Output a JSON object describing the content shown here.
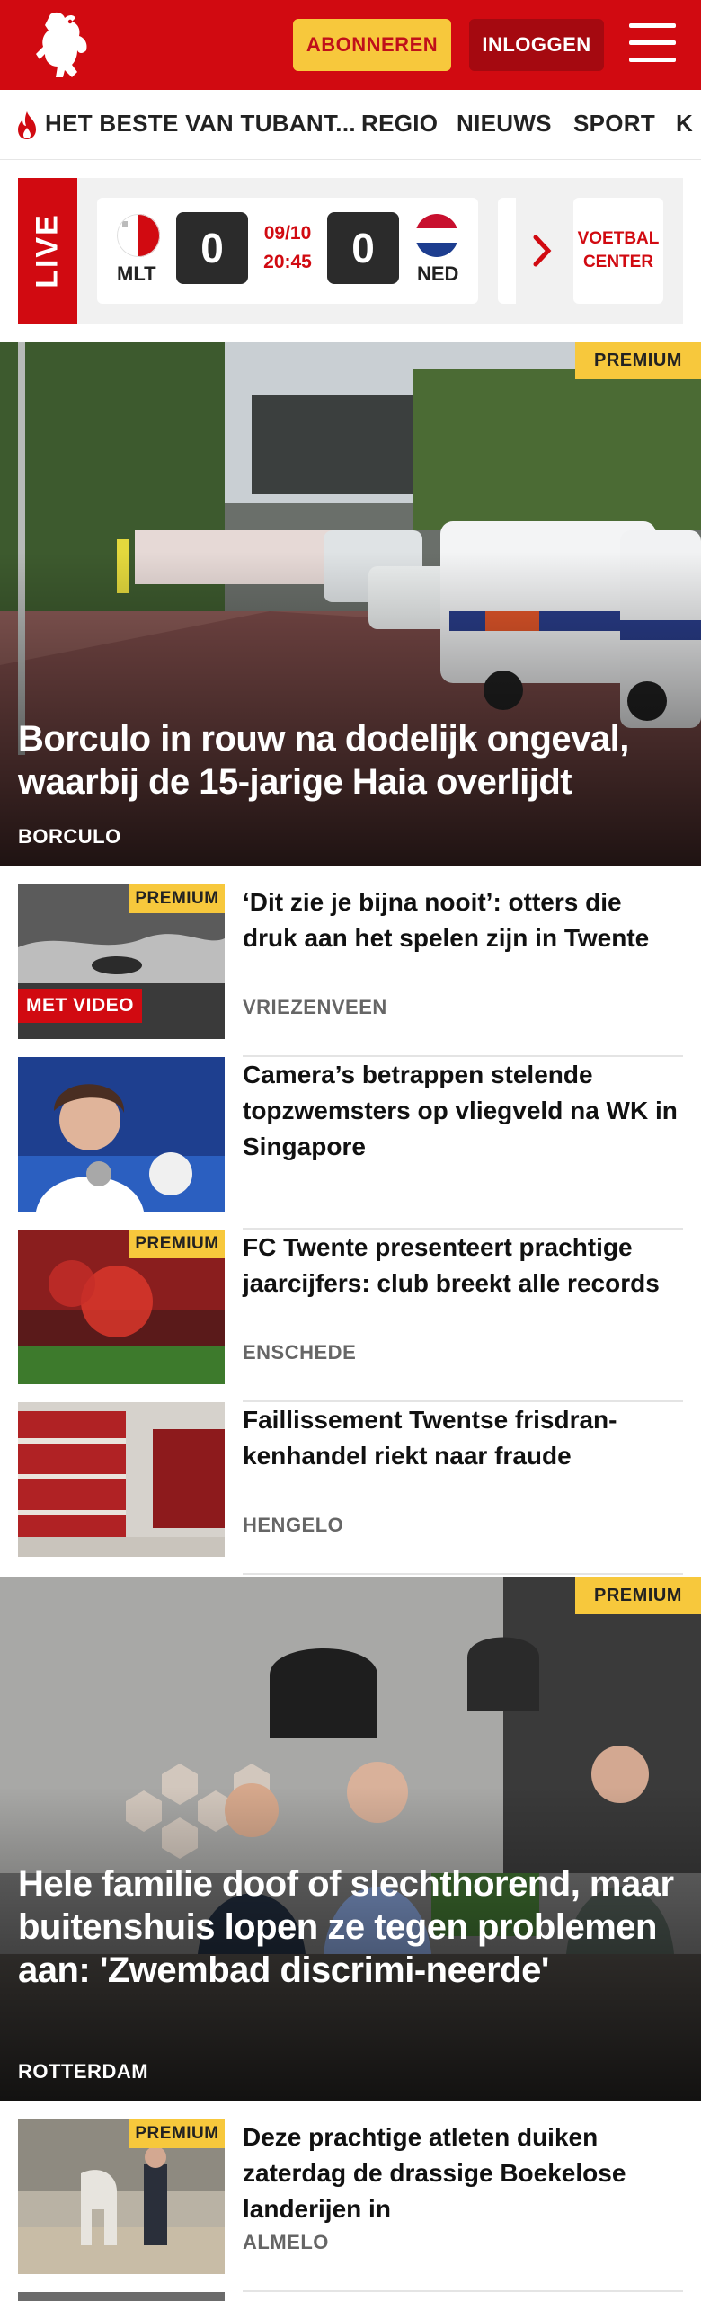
{
  "header": {
    "subscribe_label": "ABONNEREN",
    "login_label": "INLOGGEN"
  },
  "nav": {
    "items": [
      "HET BESTE VAN TUBANT...",
      "REGIO",
      "NIEUWS",
      "SPORT",
      "K"
    ]
  },
  "live": {
    "label": "LIVE",
    "home_code": "MLT",
    "away_code": "NED",
    "home_score": "0",
    "away_score": "0",
    "date": "09/10",
    "time": "20:45",
    "center_label_1": "VOETBAL",
    "center_label_2": "CENTER"
  },
  "hero1": {
    "premium": "PREMIUM",
    "title": "Borculo in rouw na dodelijk ongeval, waarbij de 15-jarige Haia overlijdt",
    "location": "BORCULO"
  },
  "items": [
    {
      "title": "‘Dit zie je bijna nooit’: otters die druk aan het spelen zijn in Twente",
      "location": "VRIEZENVEEN",
      "premium": "PREMIUM",
      "video": "MET VIDEO"
    },
    {
      "title": "Camera’s betrappen stelende topzwemsters op vliegveld na WK in Singapore",
      "location": ""
    },
    {
      "title": "FC Twente presenteert prachtige jaarcijfers: club breekt alle records",
      "location": "ENSCHEDE",
      "premium": "PREMIUM"
    },
    {
      "title": "Faillissement Twentse frisdran-kenhandel riekt naar fraude",
      "location": "HENGELO"
    }
  ],
  "hero2": {
    "premium": "PREMIUM",
    "title": "Hele familie doof of slechthorend, maar buitenshuis lopen ze tegen problemen aan: 'Zwembad discrimi-neerde'",
    "location": "ROTTERDAM"
  },
  "items2": [
    {
      "title": "Deze prachtige atleten duiken zaterdag de drassige Boekelose landerijen in",
      "location": "ALMELO",
      "premium": "PREMIUM"
    }
  ],
  "colors": {
    "brand_red": "#d10a11",
    "premium_yellow": "#f7c83c",
    "dark_red": "#a50910"
  }
}
